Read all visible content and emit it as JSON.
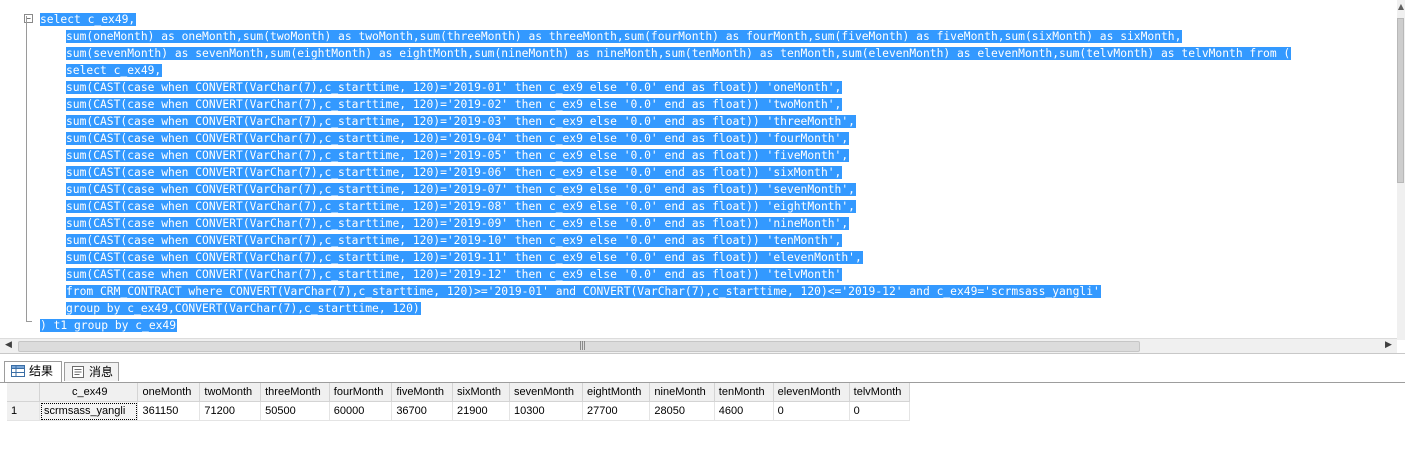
{
  "editor": {
    "lines": [
      {
        "indent": 0,
        "text": "select c_ex49,"
      },
      {
        "indent": 1,
        "text": "sum(oneMonth) as oneMonth,sum(twoMonth) as twoMonth,sum(threeMonth) as threeMonth,sum(fourMonth) as fourMonth,sum(fiveMonth) as fiveMonth,sum(sixMonth) as sixMonth,"
      },
      {
        "indent": 1,
        "text": "sum(sevenMonth) as sevenMonth,sum(eightMonth) as eightMonth,sum(nineMonth) as nineMonth,sum(tenMonth) as tenMonth,sum(elevenMonth) as elevenMonth,sum(telvMonth) as telvMonth from ("
      },
      {
        "indent": 1,
        "text": "select c_ex49,"
      },
      {
        "indent": 1,
        "text": "sum(CAST(case when CONVERT(VarChar(7),c_starttime, 120)='2019-01' then c_ex9 else '0.0' end as float)) 'oneMonth',"
      },
      {
        "indent": 1,
        "text": "sum(CAST(case when CONVERT(VarChar(7),c_starttime, 120)='2019-02' then c_ex9 else '0.0' end as float)) 'twoMonth',"
      },
      {
        "indent": 1,
        "text": "sum(CAST(case when CONVERT(VarChar(7),c_starttime, 120)='2019-03' then c_ex9 else '0.0' end as float)) 'threeMonth',"
      },
      {
        "indent": 1,
        "text": "sum(CAST(case when CONVERT(VarChar(7),c_starttime, 120)='2019-04' then c_ex9 else '0.0' end as float)) 'fourMonth',"
      },
      {
        "indent": 1,
        "text": "sum(CAST(case when CONVERT(VarChar(7),c_starttime, 120)='2019-05' then c_ex9 else '0.0' end as float)) 'fiveMonth',"
      },
      {
        "indent": 1,
        "text": "sum(CAST(case when CONVERT(VarChar(7),c_starttime, 120)='2019-06' then c_ex9 else '0.0' end as float)) 'sixMonth',"
      },
      {
        "indent": 1,
        "text": "sum(CAST(case when CONVERT(VarChar(7),c_starttime, 120)='2019-07' then c_ex9 else '0.0' end as float)) 'sevenMonth',"
      },
      {
        "indent": 1,
        "text": "sum(CAST(case when CONVERT(VarChar(7),c_starttime, 120)='2019-08' then c_ex9 else '0.0' end as float)) 'eightMonth',"
      },
      {
        "indent": 1,
        "text": "sum(CAST(case when CONVERT(VarChar(7),c_starttime, 120)='2019-09' then c_ex9 else '0.0' end as float)) 'nineMonth',"
      },
      {
        "indent": 1,
        "text": "sum(CAST(case when CONVERT(VarChar(7),c_starttime, 120)='2019-10' then c_ex9 else '0.0' end as float)) 'tenMonth',"
      },
      {
        "indent": 1,
        "text": "sum(CAST(case when CONVERT(VarChar(7),c_starttime, 120)='2019-11' then c_ex9 else '0.0' end as float)) 'elevenMonth',"
      },
      {
        "indent": 1,
        "text": "sum(CAST(case when CONVERT(VarChar(7),c_starttime, 120)='2019-12' then c_ex9 else '0.0' end as float)) 'telvMonth'"
      },
      {
        "indent": 1,
        "text": "from CRM_CONTRACT where CONVERT(VarChar(7),c_starttime, 120)>='2019-01' and CONVERT(VarChar(7),c_starttime, 120)<='2019-12' and c_ex49='scrmsass_yangli'"
      },
      {
        "indent": 1,
        "text": "group by c_ex49,CONVERT(VarChar(7),c_starttime, 120)"
      },
      {
        "indent": 0,
        "text": ") t1 group by c_ex49"
      }
    ],
    "selection_color": "#3399ff"
  },
  "tabs": [
    {
      "label": "结果",
      "icon": "grid-icon",
      "active": true
    },
    {
      "label": "消息",
      "icon": "message-icon",
      "active": false
    }
  ],
  "grid": {
    "columns": [
      "c_ex49",
      "oneMonth",
      "twoMonth",
      "threeMonth",
      "fourMonth",
      "fiveMonth",
      "sixMonth",
      "sevenMonth",
      "eightMonth",
      "nineMonth",
      "tenMonth",
      "elevenMonth",
      "telvMonth"
    ],
    "rows": [
      {
        "num": "1",
        "cells": [
          "scrmsass_yangli",
          "361150",
          "71200",
          "50500",
          "60000",
          "36700",
          "21900",
          "10300",
          "27700",
          "28050",
          "4600",
          "0",
          "0"
        ]
      }
    ]
  }
}
